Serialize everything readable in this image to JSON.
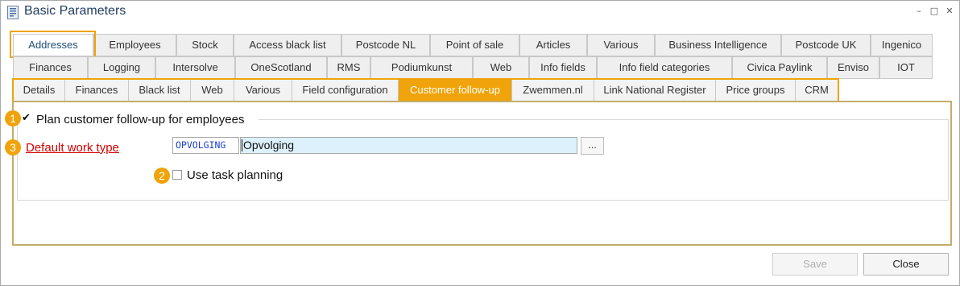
{
  "window": {
    "title": "Basic Parameters"
  },
  "tabs_row1": [
    "Addresses",
    "Employees",
    "Stock",
    "Access black list",
    "Postcode NL",
    "Point of sale",
    "Articles",
    "Various",
    "Business Intelligence",
    "Postcode UK",
    "Ingenico"
  ],
  "tabs_row2": [
    "Finances",
    "Logging",
    "Intersolve",
    "OneScotland",
    "RMS",
    "Podiumkunst",
    "Web",
    "Info fields",
    "Info field categories",
    "Civica Paylink",
    "Enviso",
    "IOT"
  ],
  "subtabs": [
    "Details",
    "Finances",
    "Black list",
    "Web",
    "Various",
    "Field configuration",
    "Customer follow-up",
    "Zwemmen.nl",
    "Link National Register",
    "Price groups",
    "CRM"
  ],
  "active_subtab": "Customer follow-up",
  "form": {
    "plan_followup": {
      "badge": "1",
      "label": "Plan customer follow-up for employees",
      "checked": true
    },
    "work_type": {
      "badge": "3",
      "label": "Default work type",
      "code": "OPVOLGING",
      "description": "Opvolging",
      "lookup_label": "..."
    },
    "task_planning": {
      "badge": "2",
      "label": "Use task planning",
      "checked": false
    }
  },
  "buttons": {
    "save": "Save",
    "close": "Close"
  },
  "colors": {
    "accent": "#f0a30a",
    "link_red": "#d40000",
    "title": "#1e3a5f",
    "field_highlight": "#dcf1fb"
  }
}
